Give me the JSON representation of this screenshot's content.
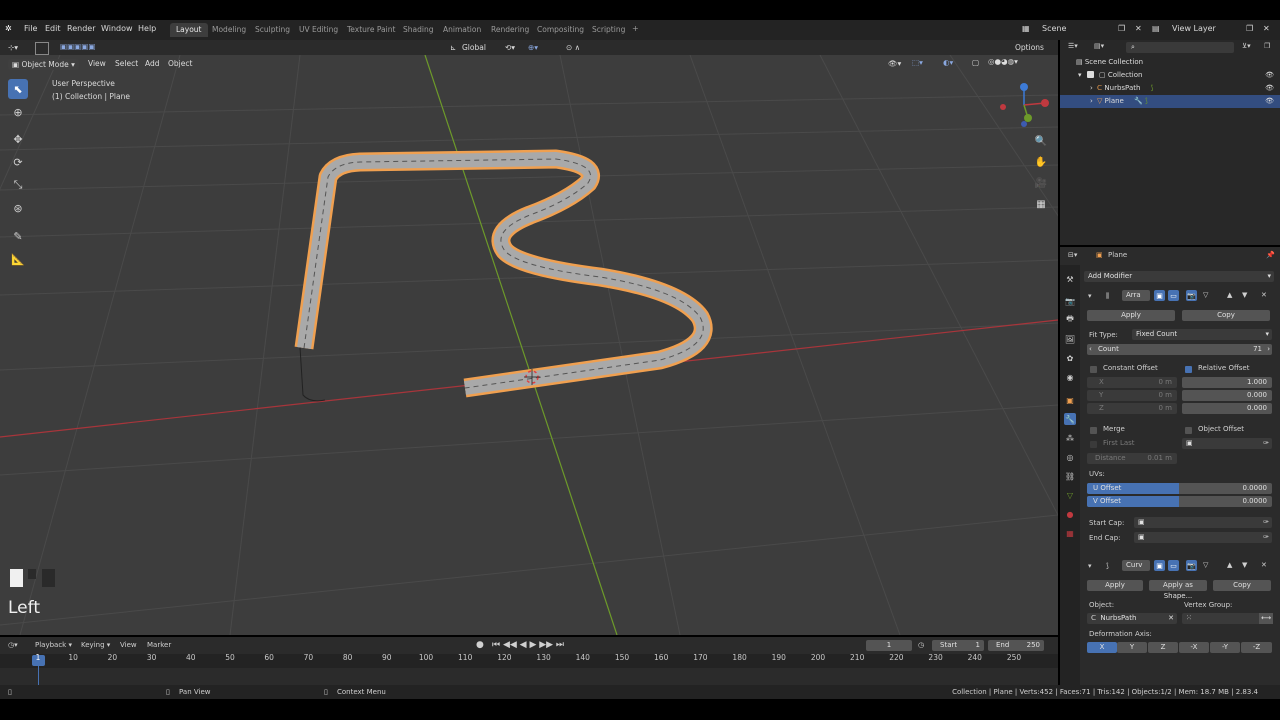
{
  "topbar": {
    "menus": [
      "File",
      "Edit",
      "Render",
      "Window",
      "Help"
    ],
    "workspaces": [
      "Layout",
      "Modeling",
      "Sculpting",
      "UV Editing",
      "Texture Paint",
      "Shading",
      "Animation",
      "Rendering",
      "Compositing",
      "Scripting"
    ],
    "active_workspace": "Layout",
    "scene": "Scene",
    "view_layer": "View Layer"
  },
  "header": {
    "mode": "Object Mode",
    "menus": [
      "View",
      "Select",
      "Add",
      "Object"
    ],
    "transform_orientation": "Global",
    "options": "Options"
  },
  "viewport": {
    "perspective": "User Perspective",
    "collection_info": "(1) Collection | Plane",
    "keystroke": "Left",
    "colors": {
      "selection": "#f0a050",
      "grid": "#4a4a4a",
      "x_axis": "#c0393f",
      "y_axis": "#7ca52e"
    }
  },
  "outliner": {
    "root": "Scene Collection",
    "collection": "Collection",
    "items": [
      "NurbsPath",
      "Plane"
    ],
    "selected": "Plane"
  },
  "properties": {
    "object_name": "Plane",
    "add_modifier": "Add Modifier",
    "array": {
      "name": "Arra",
      "apply": "Apply",
      "copy": "Copy",
      "fit_type_label": "Fit Type:",
      "fit_type": "Fixed Count",
      "count_label": "Count",
      "count": "71",
      "constant_offset": "Constant Offset",
      "relative_offset": "Relative Offset",
      "const_x": "X",
      "const_x_val": "0 m",
      "const_y": "Y",
      "const_y_val": "0 m",
      "const_z": "Z",
      "const_z_val": "0 m",
      "rel_x": "1.000",
      "rel_y": "0.000",
      "rel_z": "0.000",
      "merge": "Merge",
      "object_offset": "Object Offset",
      "first_last": "First Last",
      "distance_label": "Distance",
      "distance": "0.01 m",
      "uvs_label": "UVs:",
      "u_offset_label": "U Offset",
      "u_offset": "0.0000",
      "v_offset_label": "V Offset",
      "v_offset": "0.0000",
      "start_cap": "Start Cap:",
      "end_cap": "End Cap:"
    },
    "curve": {
      "name": "Curv",
      "apply": "Apply",
      "apply_shape": "Apply as Shape...",
      "copy": "Copy",
      "object_label": "Object:",
      "object": "NurbsPath",
      "vgroup_label": "Vertex Group:",
      "deform_axis_label": "Deformation Axis:",
      "axes": [
        "X",
        "Y",
        "Z",
        "-X",
        "-Y",
        "-Z"
      ],
      "active_axis": "X"
    }
  },
  "timeline": {
    "menus": [
      "Playback",
      "Keying",
      "View",
      "Marker"
    ],
    "current_frame": "1",
    "start_label": "Start",
    "start": "1",
    "end_label": "End",
    "end": "250",
    "ruler": [
      "1",
      "10",
      "20",
      "30",
      "40",
      "50",
      "60",
      "70",
      "80",
      "90",
      "100",
      "110",
      "120",
      "130",
      "140",
      "150",
      "160",
      "170",
      "180",
      "190",
      "200",
      "210",
      "220",
      "230",
      "240",
      "250"
    ]
  },
  "statusbar": {
    "pan": "Pan View",
    "context": "Context Menu",
    "stats": "Collection | Plane | Verts:452 | Faces:71 | Tris:142 | Objects:1/2 | Mem: 18.7 MB | 2.83.4"
  }
}
